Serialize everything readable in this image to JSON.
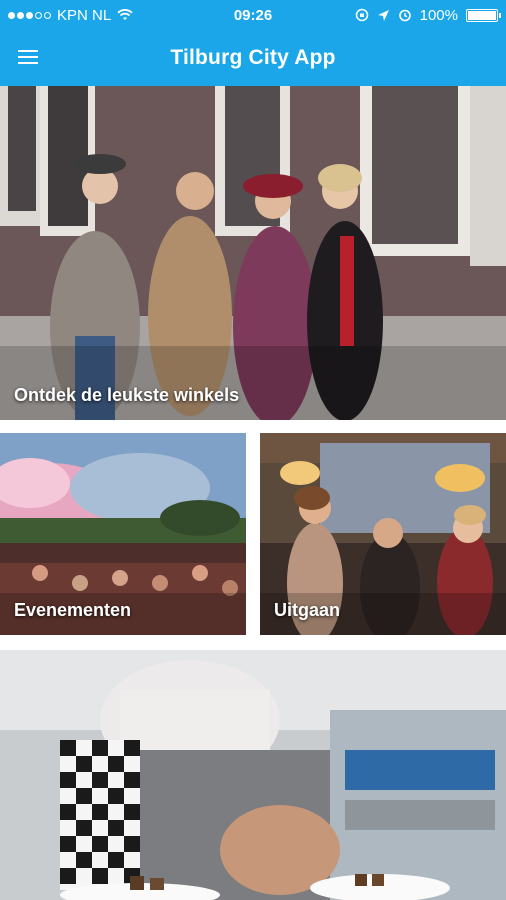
{
  "status_bar": {
    "carrier": "KPN NL",
    "time": "09:26",
    "battery": "100%",
    "battery_level": 1.0,
    "icons": [
      "signal-dots-icon",
      "wifi-icon",
      "rotation-lock-icon",
      "location-arrow-icon",
      "alarm-icon",
      "battery-icon"
    ]
  },
  "app_bar": {
    "title": "Tilburg City App",
    "menu_icon": "hamburger-menu-icon"
  },
  "tiles": {
    "shops": {
      "label": "Ontdek de leukste winkels"
    },
    "events": {
      "label": "Evenementen"
    },
    "nightlife": {
      "label": "Uitgaan"
    },
    "food": {
      "label": ""
    }
  },
  "colors": {
    "primary": "#1aa6e8",
    "text_on_primary": "#ffffff"
  }
}
